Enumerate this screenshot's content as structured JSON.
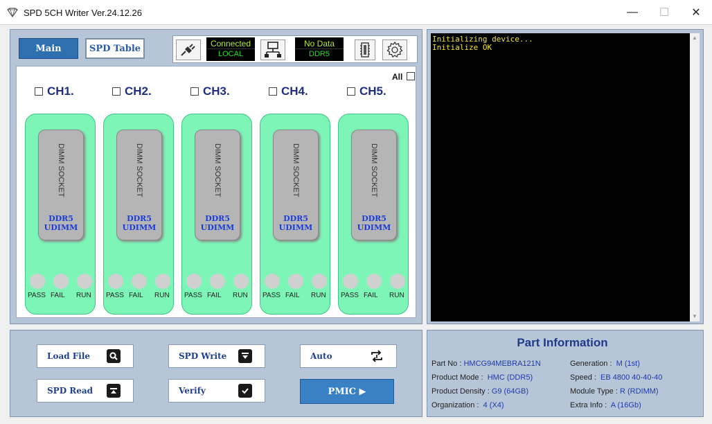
{
  "window": {
    "title": "SPD 5CH Writer Ver.24.12.26",
    "min_glyph": "—",
    "max_glyph": "☐",
    "close_glyph": "✕"
  },
  "tabs": {
    "main": "Main",
    "spd_table": "SPD Table"
  },
  "status": {
    "connection": "Connected",
    "mode": "LOCAL",
    "data": "No Data",
    "ddr": "DDR5",
    "icons": [
      "plug-icon",
      "network-icon",
      "memory-icon",
      "gear-icon"
    ]
  },
  "channels": {
    "all_label": "All",
    "items": [
      {
        "label": "CH1.",
        "socket": "DIMM SOCKET",
        "ddr": "DDR5",
        "type": "UDIMM"
      },
      {
        "label": "CH2.",
        "socket": "DIMM SOCKET",
        "ddr": "DDR5",
        "type": "UDIMM"
      },
      {
        "label": "CH3.",
        "socket": "DIMM SOCKET",
        "ddr": "DDR5",
        "type": "UDIMM"
      },
      {
        "label": "CH4.",
        "socket": "DIMM SOCKET",
        "ddr": "DDR5",
        "type": "UDIMM"
      },
      {
        "label": "CH5.",
        "socket": "DIMM SOCKET",
        "ddr": "DDR5",
        "type": "UDIMM"
      }
    ],
    "led_labels": {
      "pass": "PASS",
      "fail": "FAIL",
      "run": "RUN"
    }
  },
  "log": {
    "lines": [
      "Initializing device...",
      "Initialize OK"
    ]
  },
  "buttons": {
    "load_file": "Load File",
    "spd_read": "SPD Read",
    "spd_write": "SPD Write",
    "verify": "Verify",
    "auto": "Auto",
    "pmic": "PMIC ▶"
  },
  "part_info": {
    "title": "Part Information",
    "part_no_label": "Part No :",
    "part_no": "HMCG94MEBRA121N",
    "generation_label": "Generation :",
    "generation": "M (1st)",
    "product_mode_label": "Product Mode :",
    "product_mode": "HMC (DDR5)",
    "speed_label": "Speed :",
    "speed": "EB  4800 40-40-40",
    "product_density_label": "Product Density :",
    "product_density": "G9 (64GB)",
    "module_type_label": "Module Type :",
    "module_type": "R (RDIMM)",
    "organization_label": "Organization :",
    "organization": "4 (X4)",
    "extra_info_label": "Extra Info :",
    "extra_info": "A (16Gb)"
  },
  "colors": {
    "panel": "#b6c6d8",
    "slot_green": "#7cf5b7",
    "tab_active": "#2e6fb0",
    "channel_text": "#1f2f80",
    "ddr_text": "#1a3cdb",
    "log_text": "#f0e23a"
  }
}
